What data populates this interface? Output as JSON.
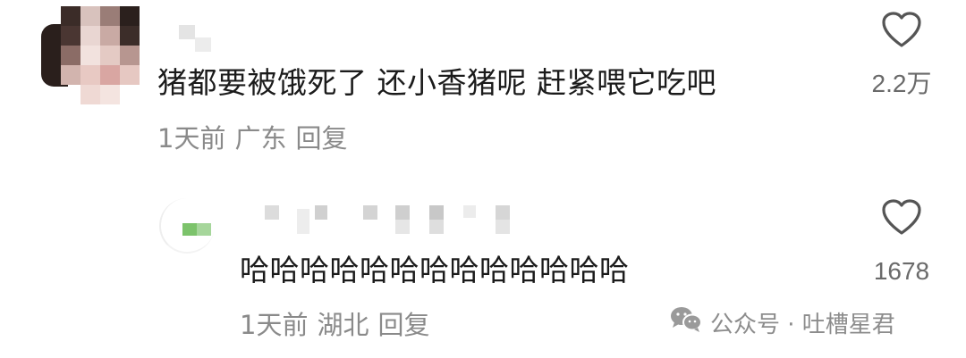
{
  "comments": [
    {
      "text": "猪都要被饿死了 还小香猪呢 赶紧喂它吃吧",
      "time": "1天前",
      "location": "广东",
      "reply_label": "回复",
      "likes": "2.2万"
    },
    {
      "text": "哈哈哈哈哈哈哈哈哈哈哈哈哈",
      "time": "1天前",
      "location": "湖北",
      "reply_label": "回复",
      "likes": "1678"
    }
  ],
  "watermark": {
    "icon": "wechat-icon",
    "text": "公众号 · 吐槽星君"
  },
  "colors": {
    "text": "#1b1b1b",
    "meta": "#8a8a8a",
    "icon": "#555555",
    "avatar_accent": "#7cc36b"
  }
}
